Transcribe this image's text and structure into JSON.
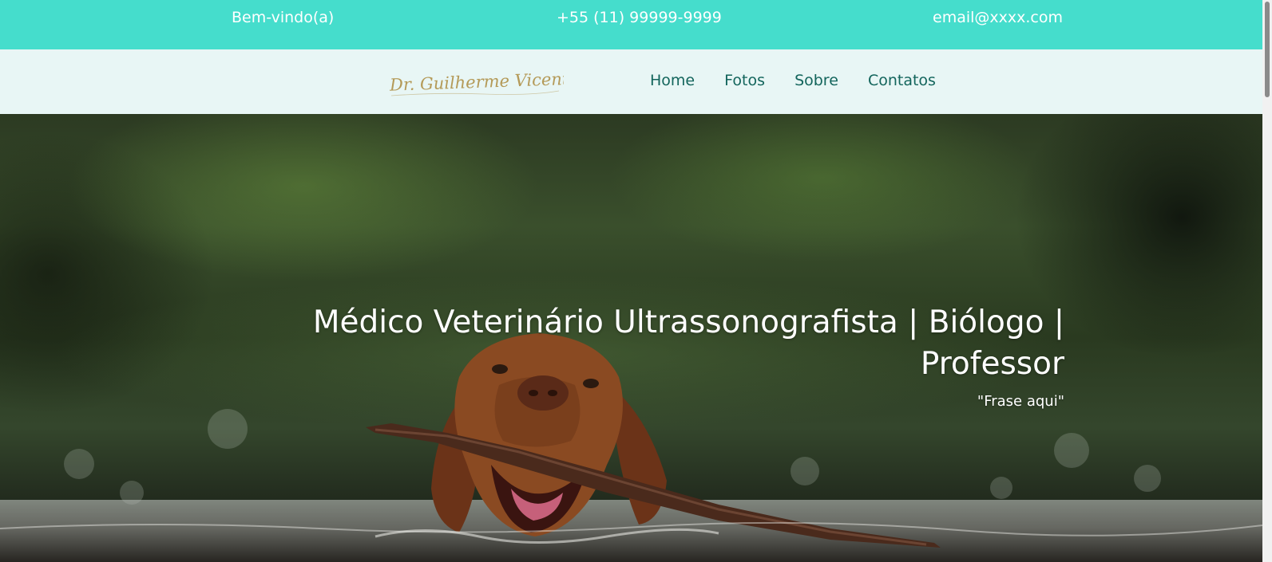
{
  "topbar": {
    "welcome": "Bem-vindo(a)",
    "phone": "+55 (11) 99999-9999",
    "email": "email@xxxx.com",
    "background_color": "#45ddcc"
  },
  "header": {
    "logo_text": "Dr. Guilherme Vicentin",
    "nav": {
      "home": "Home",
      "fotos": "Fotos",
      "sobre": "Sobre",
      "contatos": "Contatos"
    },
    "background_color": "#e8f6f5",
    "link_color": "#13655c"
  },
  "hero": {
    "title": "Médico Veterinário Ultrassonografista | Biólogo | Professor",
    "quote": "\"Frase aqui\"",
    "image_subject": "dog-swimming-with-stick-photo"
  }
}
